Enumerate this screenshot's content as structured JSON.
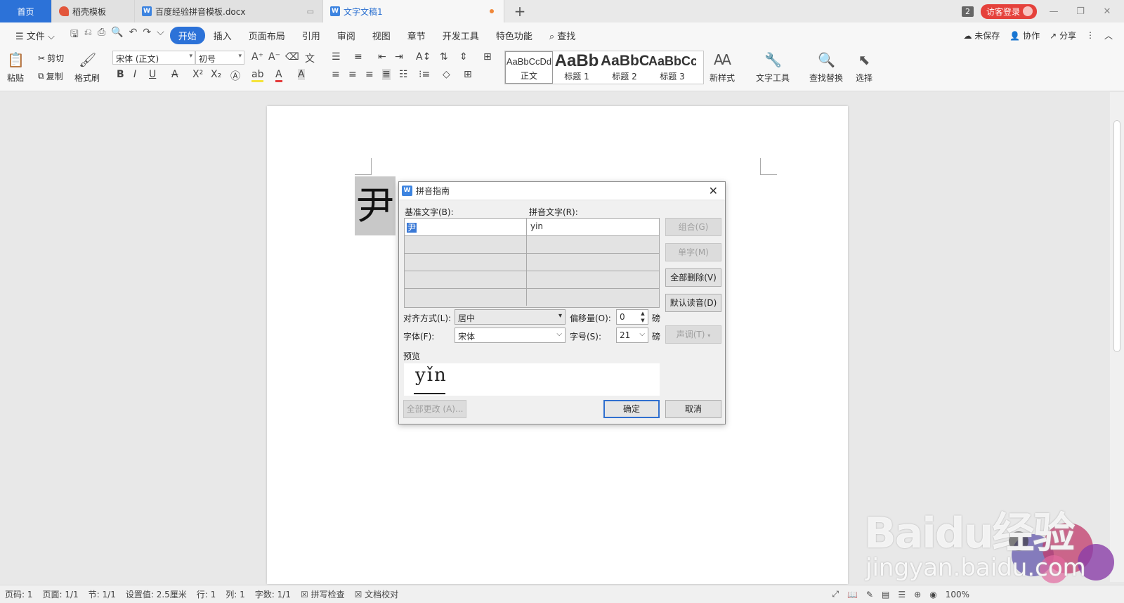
{
  "titlebar": {
    "tabs": [
      {
        "label": "首页"
      },
      {
        "label": "稻壳模板"
      },
      {
        "label": "百度经验拼音模板.docx"
      },
      {
        "label": "文字文稿1"
      }
    ],
    "new_tab": "+",
    "badge": "2",
    "login": "访客登录"
  },
  "menubar": {
    "file": "文件",
    "items": [
      "开始",
      "插入",
      "页面布局",
      "引用",
      "审阅",
      "视图",
      "章节",
      "开发工具",
      "特色功能"
    ],
    "search": "查找",
    "unsaved": "未保存",
    "collab": "协作",
    "share": "分享"
  },
  "ribbon": {
    "paste": "粘贴",
    "cut": "剪切",
    "copy": "复制",
    "format_painter": "格式刷",
    "font_name": "宋体 (正文)",
    "font_size": "初号",
    "styles": [
      {
        "preview": "AaBbCcDd",
        "name": "正文"
      },
      {
        "preview": "AaBb",
        "name": "标题 1"
      },
      {
        "preview": "AaBbC",
        "name": "标题 2"
      },
      {
        "preview": "AaBbCc",
        "name": "标题 3"
      }
    ],
    "new_style": "新样式",
    "text_tools": "文字工具",
    "find_replace": "查找替换",
    "select": "选择"
  },
  "document": {
    "selected_char": "尹"
  },
  "dialog": {
    "title": "拼音指南",
    "base_label": "基准文字(B):",
    "ruby_label": "拼音文字(R):",
    "rows": [
      {
        "base": "尹",
        "ruby": "yin"
      },
      {
        "base": "",
        "ruby": ""
      },
      {
        "base": "",
        "ruby": ""
      },
      {
        "base": "",
        "ruby": ""
      },
      {
        "base": "",
        "ruby": ""
      }
    ],
    "buttons": {
      "group": "组合(G)",
      "mono": "单字(M)",
      "clear_all": "全部删除(V)",
      "default": "默认读音(D)",
      "tone": "声调(T)",
      "change_all": "全部更改 (A)...",
      "ok": "确定",
      "cancel": "取消"
    },
    "align_label": "对齐方式(L):",
    "align_value": "居中",
    "offset_label": "偏移量(O):",
    "offset_value": "0",
    "offset_unit": "磅",
    "font_label": "字体(F):",
    "font_value": "宋体",
    "size_label": "字号(S):",
    "size_value": "21",
    "size_unit": "磅",
    "preview_label": "预览",
    "preview_text": "yǐn"
  },
  "statusbar": {
    "page_code": "页码: 1",
    "page": "页面: 1/1",
    "section": "节: 1/1",
    "setting": "设置值: 2.5厘米",
    "row": "行: 1",
    "col": "列: 1",
    "words": "字数: 1/1",
    "spell": "拼写检查",
    "proof": "文档校对",
    "zoom": "100%"
  },
  "watermark": {
    "line1": "Baidu经验",
    "line2": "jingyan.baidu.com"
  },
  "colors": {
    "accent": "#2c72d8",
    "login": "#e5413b"
  }
}
